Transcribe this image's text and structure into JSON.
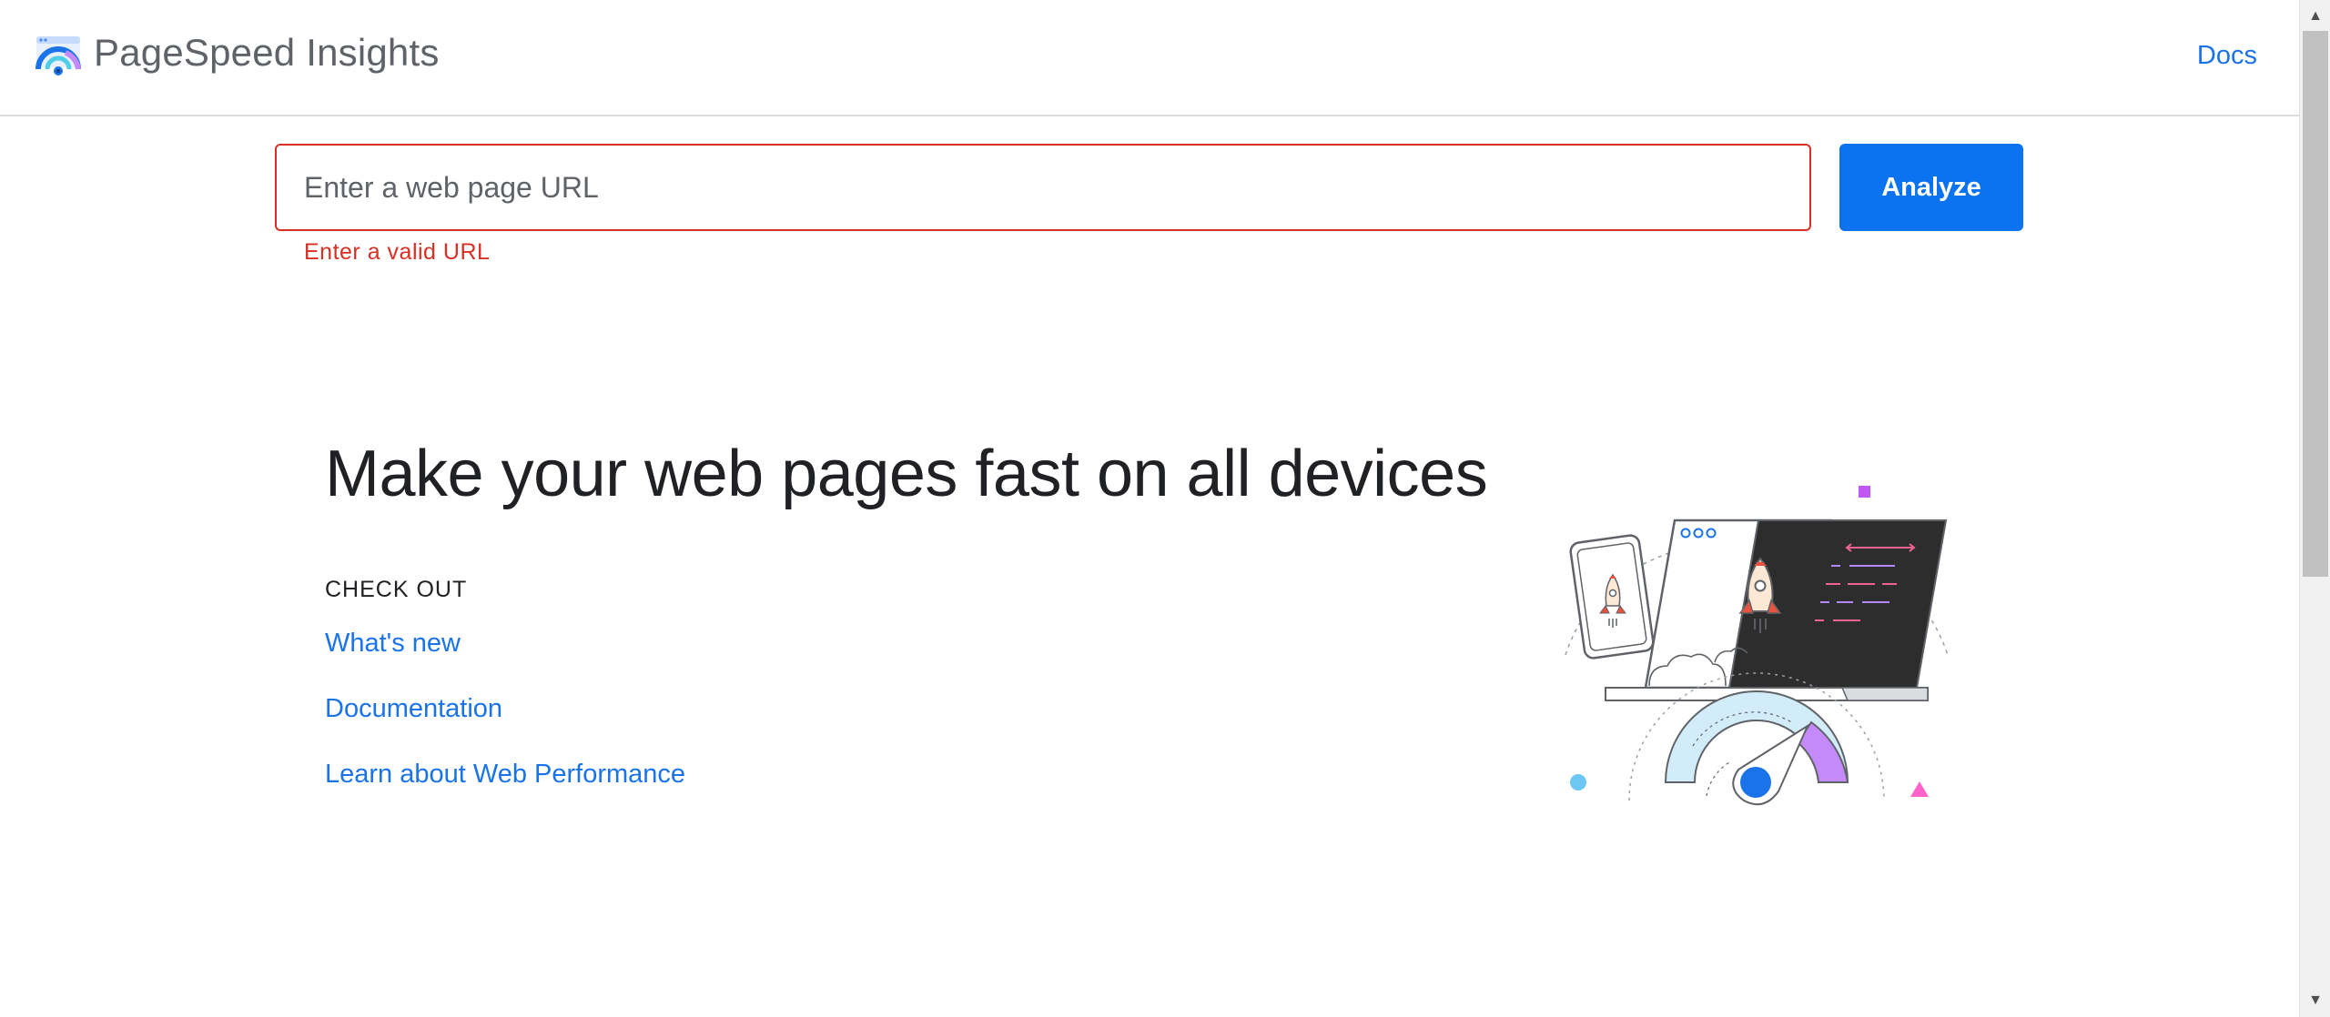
{
  "header": {
    "brand": "PageSpeed Insights",
    "docs_label": "Docs"
  },
  "search": {
    "placeholder": "Enter a web page URL",
    "value": "",
    "error": "Enter a valid URL",
    "analyze_label": "Analyze"
  },
  "hero": {
    "title": "Make your web pages fast on all devices",
    "check_out_label": "CHECK OUT",
    "links": [
      {
        "label": "What's new"
      },
      {
        "label": "Documentation"
      },
      {
        "label": "Learn about Web Performance"
      }
    ]
  },
  "colors": {
    "accent": "#1a73e8",
    "button": "#0b72f0",
    "error": "#d93025"
  },
  "icons": {
    "logo": "pagespeed-logo-icon",
    "illustration": "speed-illustration"
  }
}
